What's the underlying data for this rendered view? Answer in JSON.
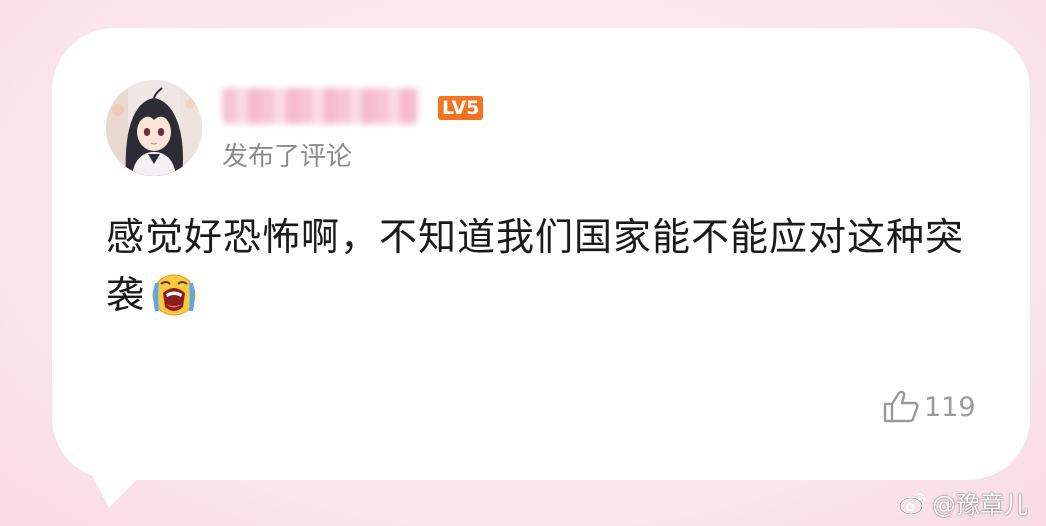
{
  "comment": {
    "username": "",
    "level_badge": "LV5",
    "action": "发布了评论",
    "text": "感觉好恐怖啊，不知道我们国家能不能应对这种突袭",
    "emoji": "crying-face-emoji",
    "like_icon": "thumbs-up-icon",
    "like_count": "119"
  },
  "watermark": {
    "icon": "weibo-logo-icon",
    "text": "@豫章儿"
  },
  "colors": {
    "background": "#fce8ee",
    "bubble": "#ffffff",
    "level_badge": "#f3731e",
    "muted_text": "#8c8c8c",
    "body_text": "#1a1a1a"
  }
}
